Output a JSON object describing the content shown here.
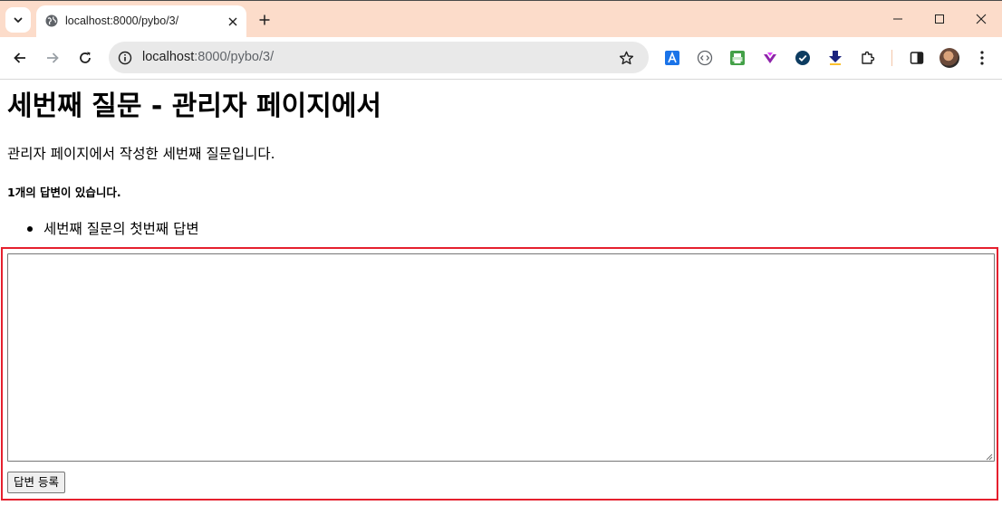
{
  "browser": {
    "tab": {
      "title": "localhost:8000/pybo/3/"
    },
    "address_bar": {
      "host": "localhost",
      "rest": ":8000/pybo/3/"
    },
    "colors": {
      "tabbar_bg": "#fcdcca",
      "highlight": "#e5202e"
    },
    "extensions": [
      "translate-icon",
      "code-icon",
      "printer-icon",
      "spark-icon",
      "check-circle-icon",
      "download-arrow-icon",
      "puzzle-icon"
    ]
  },
  "page": {
    "title": "세번째 질문 - 관리자 페이지에서",
    "description": "관리자 페이지에서 작성한 세번째 질문입니다.",
    "answer_count": "1개의 답변이 있습니다.",
    "answers": [
      "세번째 질문의 첫번째 답변"
    ],
    "answer_form": {
      "textarea_value": "",
      "submit_label": "답변 등록"
    }
  }
}
